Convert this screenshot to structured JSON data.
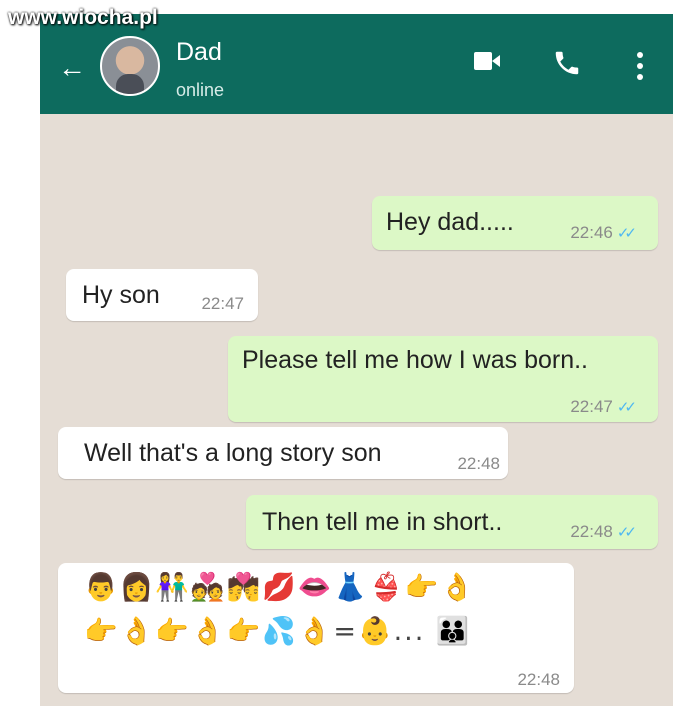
{
  "watermark": "www.wiocha.pl",
  "header": {
    "contact_name": "Dad",
    "status": "online",
    "back_glyph": "←",
    "icons": [
      "back-arrow-icon",
      "avatar",
      "video-call-icon",
      "phone-call-icon",
      "more-options-icon"
    ]
  },
  "messages": [
    {
      "dir": "out",
      "text": "Hey dad.....",
      "time": "22:46",
      "ticks": "✓✓"
    },
    {
      "dir": "in",
      "text": "Hy son",
      "time": "22:47"
    },
    {
      "dir": "out",
      "text": "Please tell me how I was born..",
      "time": "22:47",
      "ticks": "✓✓"
    },
    {
      "dir": "in",
      "text": "Well that's a long story son",
      "time": "22:48"
    },
    {
      "dir": "out",
      "text": "Then tell me in short..",
      "time": "22:48",
      "ticks": "✓✓"
    },
    {
      "dir": "in",
      "emoji_line1": "👨👩👫💑💏💋👄👗👙👉👌",
      "emoji_line2": "👉👌👉👌👉💦👌=👶... 👪",
      "time": "22:48"
    }
  ],
  "colors": {
    "header": "#0d6b5e",
    "chat_bg": "#e5ddd5",
    "outgoing": "#dcf8c6",
    "incoming": "#ffffff",
    "read_ticks": "#4fb8f1"
  }
}
